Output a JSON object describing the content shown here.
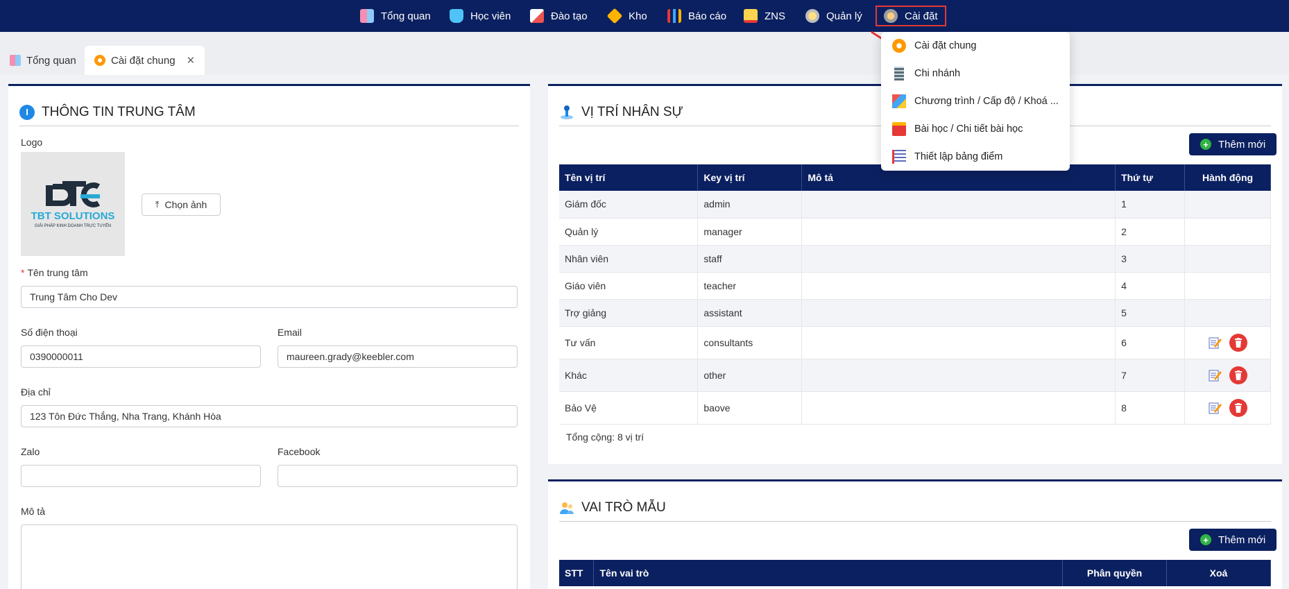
{
  "nav": {
    "items": [
      {
        "label": "Tổng quan",
        "icon": "dashboard-icon"
      },
      {
        "label": "Học viên",
        "icon": "student-icon"
      },
      {
        "label": "Đào tạo",
        "icon": "training-icon"
      },
      {
        "label": "Kho",
        "icon": "warehouse-icon"
      },
      {
        "label": "Báo cáo",
        "icon": "report-icon"
      },
      {
        "label": "ZNS",
        "icon": "zns-icon"
      },
      {
        "label": "Quản lý",
        "icon": "manage-icon"
      },
      {
        "label": "Cài đặt",
        "icon": "settings-icon"
      }
    ]
  },
  "tabs": [
    {
      "label": "Tổng quan"
    },
    {
      "label": "Cài đặt chung"
    }
  ],
  "settings_menu": {
    "items": [
      {
        "label": "Cài đặt chung",
        "icon": "gears-icon"
      },
      {
        "label": "Chi nhánh",
        "icon": "building-icon"
      },
      {
        "label": "Chương trình / Cấp độ / Khoá ...",
        "icon": "program-icon"
      },
      {
        "label": "Bài học / Chi tiết bài học",
        "icon": "lesson-icon"
      },
      {
        "label": "Thiết lập bảng điểm",
        "icon": "scoreboard-icon"
      }
    ]
  },
  "center_info": {
    "title": "THÔNG TIN TRUNG TÂM",
    "logo_label": "Logo",
    "logo_text": "TBT SOLUTIONS",
    "logo_subtext": "GIẢI PHÁP KINH DOANH TRỰC TUYẾN",
    "choose_image": "Chọn ảnh",
    "name_label": "Tên trung tâm",
    "name_value": "Trung Tâm Cho Dev",
    "phone_label": "Số điện thoại",
    "phone_value": "0390000011",
    "email_label": "Email",
    "email_value": "maureen.grady@keebler.com",
    "address_label": "Địa chỉ",
    "address_value": "123 Tôn Đức Thắng, Nha Trang, Khánh Hòa",
    "zalo_label": "Zalo",
    "zalo_value": "",
    "facebook_label": "Facebook",
    "facebook_value": "",
    "desc_label": "Mô tả",
    "desc_value": ""
  },
  "positions": {
    "title": "VỊ TRÍ NHÂN SỰ",
    "add_label": "Thêm mới",
    "headers": [
      "Tên vị trí",
      "Key vị trí",
      "Mô tả",
      "Thứ tự",
      "Hành động"
    ],
    "rows": [
      {
        "name": "Giám đốc",
        "key": "admin",
        "desc": "",
        "order": "1",
        "actions": false
      },
      {
        "name": "Quản lý",
        "key": "manager",
        "desc": "",
        "order": "2",
        "actions": false
      },
      {
        "name": "Nhân viên",
        "key": "staff",
        "desc": "",
        "order": "3",
        "actions": false
      },
      {
        "name": "Giáo viên",
        "key": "teacher",
        "desc": "",
        "order": "4",
        "actions": false
      },
      {
        "name": "Trợ giảng",
        "key": "assistant",
        "desc": "",
        "order": "5",
        "actions": false
      },
      {
        "name": "Tư vấn",
        "key": "consultants",
        "desc": "",
        "order": "6",
        "actions": true
      },
      {
        "name": "Khác",
        "key": "other",
        "desc": "",
        "order": "7",
        "actions": true
      },
      {
        "name": "Bảo Vệ",
        "key": "baove",
        "desc": "",
        "order": "8",
        "actions": true
      }
    ],
    "total": "Tổng cộng: 8 vị trí"
  },
  "roles": {
    "title": "VAI TRÒ MẪU",
    "add_label": "Thêm mới",
    "headers": [
      "STT",
      "Tên vai trò",
      "Phân quyền",
      "Xoá"
    ]
  },
  "colors": {
    "navy": "#0b2060",
    "danger": "#e53935",
    "success": "#2fb344",
    "logo_dark": "#1f2d3d",
    "logo_cyan": "#29a9d6"
  }
}
